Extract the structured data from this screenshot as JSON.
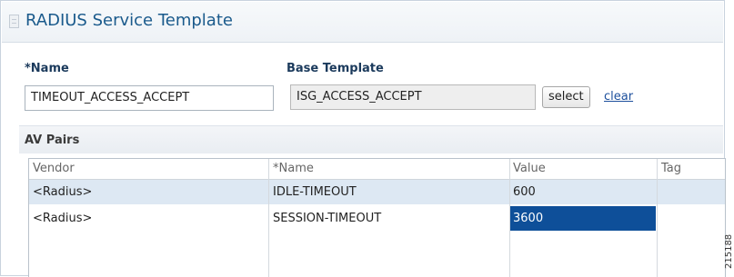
{
  "header": {
    "title": "RADIUS Service Template",
    "icon": "template-icon"
  },
  "form": {
    "name_label": "*Name",
    "name_value": "TIMEOUT_ACCESS_ACCEPT",
    "base_template_label": "Base Template",
    "base_template_value": "ISG_ACCESS_ACCEPT",
    "select_label": "select",
    "clear_label": "clear"
  },
  "av_pairs": {
    "title": "AV Pairs",
    "columns": [
      "Vendor",
      "*Name",
      "Value",
      "Tag"
    ],
    "rows": [
      {
        "vendor": "<Radius>",
        "name": "IDLE-TIMEOUT",
        "value": "600",
        "tag": "",
        "selected": true
      },
      {
        "vendor": "<Radius>",
        "name": "SESSION-TIMEOUT",
        "value": "3600",
        "tag": "",
        "editing": true
      }
    ]
  },
  "figure_id": "215188",
  "colors": {
    "title": "#1a5a8c",
    "selected_row": "#dde8f3",
    "editing_cell": "#0e4f99",
    "link": "#1c4f9c"
  }
}
